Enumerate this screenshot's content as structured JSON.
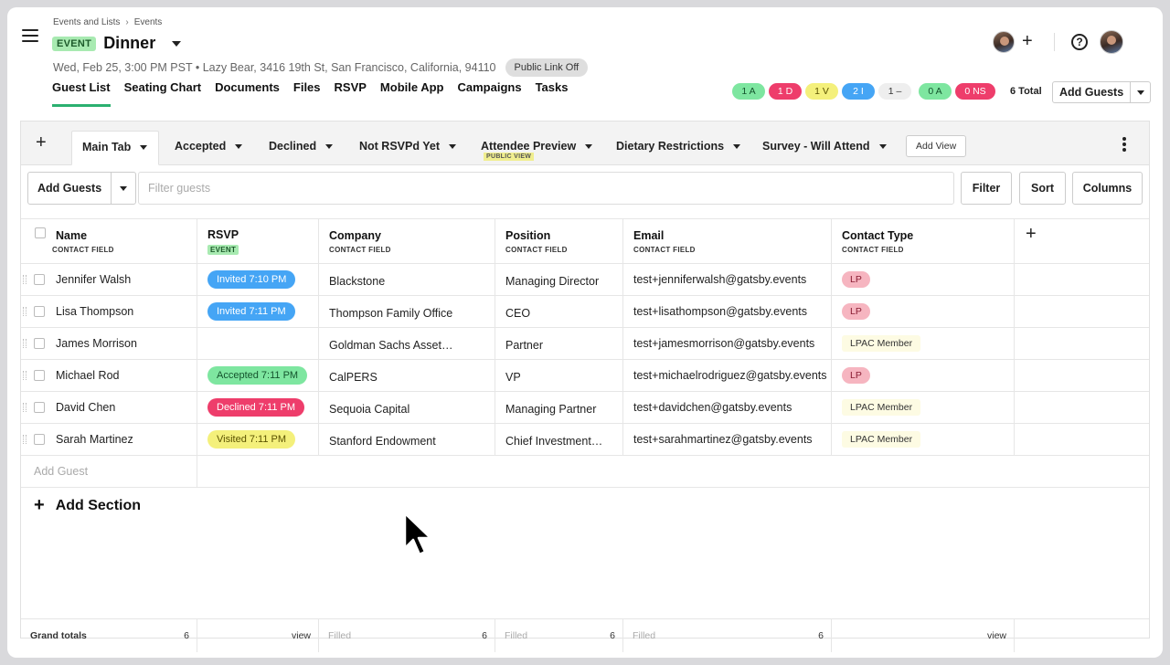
{
  "breadcrumb": {
    "parent": "Events and Lists",
    "current": "Events",
    "sep": "›"
  },
  "header": {
    "tag": "EVENT",
    "title": "Dinner",
    "subtitle": "Wed, Feb 25, 3:00 PM PST • Lazy Bear, 3416 19th St, San Francisco, California, 94110",
    "public_link": "Public Link Off",
    "help": "?",
    "plus": "+"
  },
  "nav_tabs": [
    "Guest List",
    "Seating Chart",
    "Documents",
    "Files",
    "RSVP",
    "Mobile App",
    "Campaigns",
    "Tasks"
  ],
  "status_pills": {
    "accepted": "1 A",
    "declined": "1 D",
    "visited": "1 V",
    "invited": "2 I",
    "none": "1 –",
    "na": "0 A",
    "ns": "0 NS",
    "total": "6 Total"
  },
  "add_guests_label": "Add Guests",
  "view_tabs": {
    "plus": "+",
    "tabs": [
      "Main Tab",
      "Accepted",
      "Declined",
      "Not RSVPd Yet",
      "Attendee Preview",
      "Dietary Restrictions",
      "Survey - Will Attend"
    ],
    "public_view": "PUBLIC VIEW",
    "add_view": "Add View"
  },
  "toolbar": {
    "add_guests": "Add Guests",
    "filter_placeholder": "Filter guests",
    "filter": "Filter",
    "sort": "Sort",
    "columns": "Columns"
  },
  "columns": [
    {
      "title": "Name",
      "sub": "CONTACT FIELD"
    },
    {
      "title": "RSVP",
      "sub": "EVENT"
    },
    {
      "title": "Company",
      "sub": "CONTACT FIELD"
    },
    {
      "title": "Position",
      "sub": "CONTACT FIELD"
    },
    {
      "title": "Email",
      "sub": "CONTACT FIELD"
    },
    {
      "title": "Contact Type",
      "sub": "CONTACT FIELD"
    }
  ],
  "add_column": "+",
  "rows": [
    {
      "name": "Jennifer Walsh",
      "rsvp": "Invited 7:10 PM",
      "rsvp_status": "invited",
      "company": "Blackstone",
      "position": "Managing Director",
      "email": "test+jenniferwalsh@gatsby.events",
      "contact_type": "LP",
      "ct_kind": "lp"
    },
    {
      "name": "Lisa Thompson",
      "rsvp": "Invited 7:11 PM",
      "rsvp_status": "invited",
      "company": "Thompson Family Office",
      "position": "CEO",
      "email": "test+lisathompson@gatsby.events",
      "contact_type": "LP",
      "ct_kind": "lp"
    },
    {
      "name": "James Morrison",
      "rsvp": "",
      "rsvp_status": "",
      "company": "Goldman Sachs Asset…",
      "position": "Partner",
      "email": "test+jamesmorrison@gatsby.events",
      "contact_type": "LPAC Member",
      "ct_kind": "lpac"
    },
    {
      "name": "Michael Rod",
      "rsvp": "Accepted 7:11 PM",
      "rsvp_status": "accepted",
      "company": "CalPERS",
      "position": "VP",
      "email": "test+michaelrodriguez@gatsby.events",
      "contact_type": "LP",
      "ct_kind": "lp"
    },
    {
      "name": "David Chen",
      "rsvp": "Declined 7:11 PM",
      "rsvp_status": "declined",
      "company": "Sequoia Capital",
      "position": "Managing Partner",
      "email": "test+davidchen@gatsby.events",
      "contact_type": "LPAC Member",
      "ct_kind": "lpac"
    },
    {
      "name": "Sarah Martinez",
      "rsvp": "Visited 7:11 PM",
      "rsvp_status": "visited",
      "company": "Stanford Endowment",
      "position": "Chief Investment…",
      "email": "test+sarahmartinez@gatsby.events",
      "contact_type": "LPAC Member",
      "ct_kind": "lpac"
    }
  ],
  "add_guest_row": "Add Guest",
  "add_section": {
    "plus": "+",
    "label": "Add Section"
  },
  "totals": {
    "label": "Grand totals",
    "name_count": "6",
    "rsvp_view": "view",
    "company_label": "Filled",
    "company_count": "6",
    "position_label": "Filled",
    "position_count": "6",
    "email_label": "Filled",
    "email_count": "6",
    "ct_view": "view"
  },
  "colors": {
    "accent_green": "#2bb070",
    "invited": "#45a5f5",
    "accepted": "#7ee6a0",
    "declined": "#ee3d6b",
    "visited": "#f4f07b",
    "lp": "#f6b5c0",
    "lpac": "#fdfbe3"
  }
}
